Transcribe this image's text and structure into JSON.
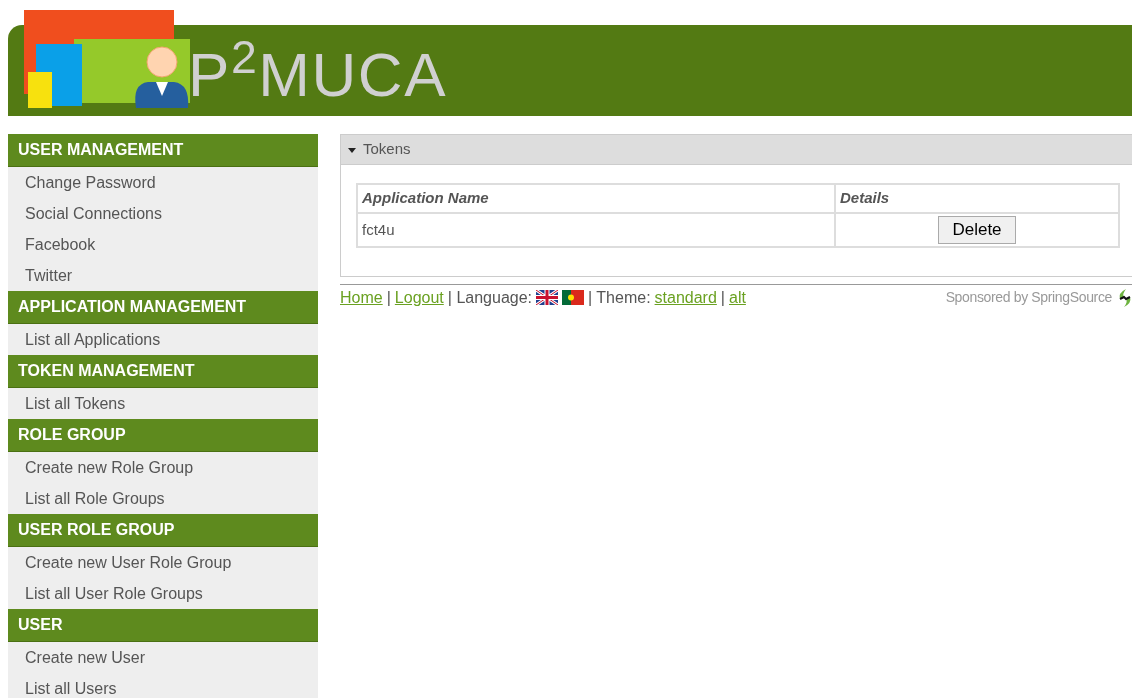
{
  "header": {
    "logo_text": "P$^{2}$MUCA"
  },
  "sidebar": {
    "sections": [
      {
        "title": "USER MANAGEMENT",
        "items": [
          "Change Password",
          "Social Connections",
          "Facebook",
          "Twitter"
        ]
      },
      {
        "title": "APPLICATION MANAGEMENT",
        "items": [
          "List all Applications"
        ]
      },
      {
        "title": "TOKEN MANAGEMENT",
        "items": [
          "List all Tokens"
        ]
      },
      {
        "title": "ROLE GROUP",
        "items": [
          "Create new Role Group",
          "List all Role Groups"
        ]
      },
      {
        "title": "USER ROLE GROUP",
        "items": [
          "Create new User Role Group",
          "List all User Role Groups"
        ]
      },
      {
        "title": "USER",
        "items": [
          "Create new User",
          "List all Users"
        ]
      }
    ]
  },
  "panel": {
    "title": "Tokens",
    "expanded": true,
    "table": {
      "columns": [
        "Application Name",
        "Details"
      ],
      "rows": [
        {
          "application_name": "fct4u",
          "action": "Delete"
        }
      ]
    }
  },
  "footer": {
    "parts": [
      {
        "kind": "link",
        "text": "Home"
      },
      {
        "kind": "text",
        "text": "|"
      },
      {
        "kind": "link",
        "text": "Logout"
      },
      {
        "kind": "text",
        "text": "| Language:"
      },
      {
        "kind": "uk_flag"
      },
      {
        "kind": "pt_flag"
      },
      {
        "kind": "text",
        "text": "| Theme:"
      },
      {
        "kind": "link",
        "text": "standard"
      },
      {
        "kind": "text",
        "text": "|"
      },
      {
        "kind": "link",
        "text": "alt"
      }
    ],
    "sponsor": "Sponsored by SpringSource"
  }
}
